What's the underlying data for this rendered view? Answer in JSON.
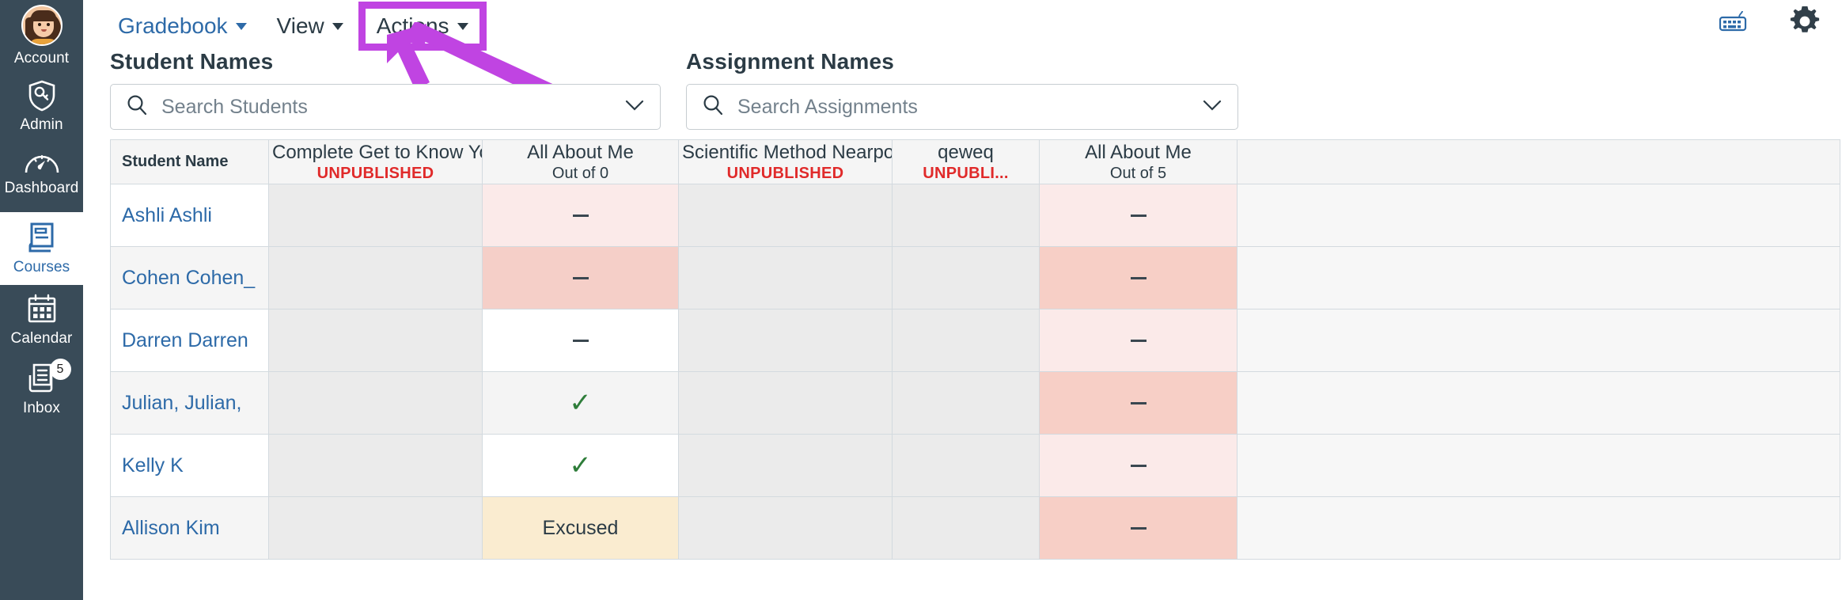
{
  "sidebar": {
    "items": [
      {
        "label": "Account",
        "icon": "avatar-icon",
        "active": false
      },
      {
        "label": "Admin",
        "icon": "shield-key-icon",
        "active": false
      },
      {
        "label": "Dashboard",
        "icon": "speedometer-icon",
        "active": false
      },
      {
        "label": "Courses",
        "icon": "book-icon",
        "active": true
      },
      {
        "label": "Calendar",
        "icon": "calendar-icon",
        "active": false
      },
      {
        "label": "Inbox",
        "icon": "inbox-icon",
        "active": false,
        "badge": "5"
      }
    ]
  },
  "menubar": {
    "gradebook_label": "Gradebook",
    "view_label": "View",
    "actions_label": "Actions"
  },
  "topright": {
    "keyboard_icon": "keyboard-shortcuts-icon",
    "settings_icon": "gear-icon"
  },
  "annotation": {
    "highlight_color": "#C044E2",
    "target": "Actions"
  },
  "search": {
    "students": {
      "title": "Student Names",
      "placeholder": "Search Students",
      "value": ""
    },
    "assignments": {
      "title": "Assignment Names",
      "placeholder": "Search Assignments",
      "value": ""
    }
  },
  "gradebook": {
    "columns": [
      {
        "title": "Student Name",
        "sub": "",
        "sub_type": "none"
      },
      {
        "title": "Complete Get to Know You",
        "sub": "UNPUBLISHED",
        "sub_type": "unpublished"
      },
      {
        "title": "All About Me",
        "sub": "Out of 0",
        "sub_type": "points"
      },
      {
        "title": "Scientific Method Nearpod",
        "sub": "UNPUBLISHED",
        "sub_type": "unpublished"
      },
      {
        "title": "qeweq",
        "sub": "UNPUBLI...",
        "sub_type": "unpublished"
      },
      {
        "title": "All About Me",
        "sub": "Out of 5",
        "sub_type": "points"
      },
      {
        "title": "",
        "sub": "",
        "sub_type": "none"
      }
    ],
    "rows": [
      {
        "name": "Ashli Ashli",
        "cells": [
          {
            "value": "",
            "kind": "empty",
            "bg": "#ebebeb"
          },
          {
            "value": "–",
            "kind": "dash",
            "bg": "#fbeae9"
          },
          {
            "value": "",
            "kind": "empty",
            "bg": "#ebebeb"
          },
          {
            "value": "",
            "kind": "empty",
            "bg": "#ebebeb"
          },
          {
            "value": "–",
            "kind": "dash",
            "bg": "#fbeae9"
          },
          {
            "value": "",
            "kind": "empty",
            "bg": "#f7f7f7"
          }
        ]
      },
      {
        "name": "Cohen Cohen_",
        "cells": [
          {
            "value": "",
            "kind": "empty",
            "bg": "#ebebeb"
          },
          {
            "value": "–",
            "kind": "dash",
            "bg": "#f5cfc8"
          },
          {
            "value": "",
            "kind": "empty",
            "bg": "#ebebeb"
          },
          {
            "value": "",
            "kind": "empty",
            "bg": "#ebebeb"
          },
          {
            "value": "–",
            "kind": "dash",
            "bg": "#f7cfc6"
          },
          {
            "value": "",
            "kind": "empty",
            "bg": "#f7f7f7"
          }
        ]
      },
      {
        "name": "Darren Darren",
        "cells": [
          {
            "value": "",
            "kind": "empty",
            "bg": "#ebebeb"
          },
          {
            "value": "–",
            "kind": "dash",
            "bg": "#ffffff"
          },
          {
            "value": "",
            "kind": "empty",
            "bg": "#ebebeb"
          },
          {
            "value": "",
            "kind": "empty",
            "bg": "#ebebeb"
          },
          {
            "value": "–",
            "kind": "dash",
            "bg": "#fbeae9"
          },
          {
            "value": "",
            "kind": "empty",
            "bg": "#f7f7f7"
          }
        ]
      },
      {
        "name": "Julian, Julian,",
        "cells": [
          {
            "value": "",
            "kind": "empty",
            "bg": "#ebebeb"
          },
          {
            "value": "✓",
            "kind": "check",
            "bg": "#f4f4f4"
          },
          {
            "value": "",
            "kind": "empty",
            "bg": "#ebebeb"
          },
          {
            "value": "",
            "kind": "empty",
            "bg": "#ebebeb"
          },
          {
            "value": "–",
            "kind": "dash",
            "bg": "#f7cfc6"
          },
          {
            "value": "",
            "kind": "empty",
            "bg": "#f7f7f7"
          }
        ]
      },
      {
        "name": "Kelly K",
        "cells": [
          {
            "value": "",
            "kind": "empty",
            "bg": "#ebebeb"
          },
          {
            "value": "✓",
            "kind": "check",
            "bg": "#ffffff"
          },
          {
            "value": "",
            "kind": "empty",
            "bg": "#ebebeb"
          },
          {
            "value": "",
            "kind": "empty",
            "bg": "#ebebeb"
          },
          {
            "value": "–",
            "kind": "dash",
            "bg": "#fbeae9"
          },
          {
            "value": "",
            "kind": "empty",
            "bg": "#f7f7f7"
          }
        ]
      },
      {
        "name": "Allison Kim",
        "cells": [
          {
            "value": "",
            "kind": "empty",
            "bg": "#ebebeb"
          },
          {
            "value": "Excused",
            "kind": "text",
            "bg": "#faecd0"
          },
          {
            "value": "",
            "kind": "empty",
            "bg": "#ebebeb"
          },
          {
            "value": "",
            "kind": "empty",
            "bg": "#ebebeb"
          },
          {
            "value": "–",
            "kind": "dash",
            "bg": "#f7cfc6"
          },
          {
            "value": "",
            "kind": "empty",
            "bg": "#f7f7f7"
          }
        ]
      }
    ]
  },
  "colors": {
    "sidebar_bg": "#394B58",
    "link_blue": "#2D6AA8",
    "unpublished_red": "#E02A2A",
    "highlight_purple": "#C044E2",
    "check_green": "#2E7D3A"
  }
}
